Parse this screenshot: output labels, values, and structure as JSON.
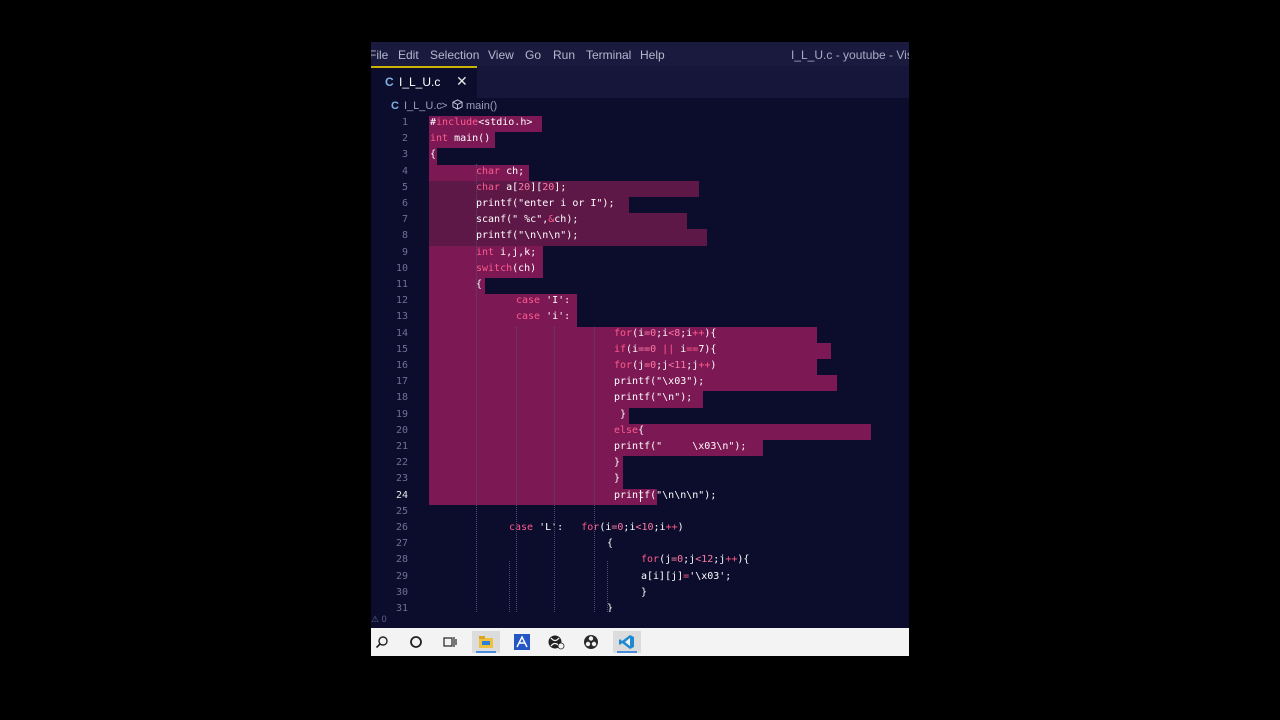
{
  "menu": {
    "items": [
      "File",
      "Edit",
      "Selection",
      "View",
      "Go",
      "Run",
      "Terminal",
      "Help"
    ],
    "window_title": "I_L_U.c - youtube - Visual Studio Code"
  },
  "tab": {
    "lang_icon": "C",
    "filename": "I_L_U.c",
    "close": "✕"
  },
  "breadcrumb": {
    "file_icon": "C",
    "file": "I_L_U.c",
    "sep": ">",
    "symbol_icon": "cube-icon",
    "symbol": "main()"
  },
  "editor": {
    "current_line": 24,
    "lines": [
      {
        "n": 1,
        "i": 0,
        "t": [
          [
            "#",
            "p"
          ],
          [
            "include",
            "k"
          ],
          [
            "<stdio.h>",
            "p"
          ]
        ]
      },
      {
        "n": 2,
        "i": 0,
        "t": [
          [
            "int ",
            "k"
          ],
          [
            "main()",
            "p"
          ]
        ]
      },
      {
        "n": 3,
        "i": 0,
        "t": [
          [
            "{",
            "p"
          ]
        ]
      },
      {
        "n": 4,
        "i": 1,
        "t": [
          [
            "char ",
            "k"
          ],
          [
            "ch;",
            "p"
          ]
        ]
      },
      {
        "n": 5,
        "i": 1,
        "t": [
          [
            "char ",
            "k"
          ],
          [
            "a[",
            "p"
          ],
          [
            "20",
            "n"
          ],
          [
            "][",
            "p"
          ],
          [
            "20",
            "n"
          ],
          [
            "];",
            "p"
          ]
        ]
      },
      {
        "n": 6,
        "i": 1,
        "t": [
          [
            "printf(\"enter i or I\");",
            "p"
          ]
        ]
      },
      {
        "n": 7,
        "i": 1,
        "t": [
          [
            "scanf(\" %c\",",
            "p"
          ],
          [
            "&",
            "k"
          ],
          [
            "ch);",
            "p"
          ]
        ]
      },
      {
        "n": 8,
        "i": 1,
        "t": [
          [
            "printf(\"\\n\\n\\n\");",
            "p"
          ]
        ]
      },
      {
        "n": 9,
        "i": 1,
        "t": [
          [
            "int ",
            "k"
          ],
          [
            "i,j,k;",
            "p"
          ]
        ]
      },
      {
        "n": 10,
        "i": 1,
        "t": [
          [
            "switch",
            "k"
          ],
          [
            "(ch)",
            "p"
          ]
        ]
      },
      {
        "n": 11,
        "i": 1,
        "t": [
          [
            "{",
            "p"
          ]
        ]
      },
      {
        "n": 12,
        "i": 2,
        "t": [
          [
            "case ",
            "k"
          ],
          [
            "'I':",
            "p"
          ]
        ]
      },
      {
        "n": 13,
        "i": 2,
        "t": [
          [
            "case ",
            "k"
          ],
          [
            "'i':",
            "p"
          ]
        ]
      },
      {
        "n": 14,
        "i": 3,
        "t": [
          [
            "for",
            "k"
          ],
          [
            "(i",
            "p"
          ],
          [
            "=0",
            "n"
          ],
          [
            ";i",
            "p"
          ],
          [
            "<8",
            "n"
          ],
          [
            ";i",
            "p"
          ],
          [
            "++",
            "k"
          ],
          [
            "){",
            "p"
          ]
        ]
      },
      {
        "n": 15,
        "i": 3,
        "t": [
          [
            "if",
            "k"
          ],
          [
            "(i",
            "p"
          ],
          [
            "==0",
            "n"
          ],
          [
            " || ",
            "k"
          ],
          [
            "i",
            "p"
          ],
          [
            "==",
            "k"
          ],
          [
            "7){",
            "p"
          ]
        ]
      },
      {
        "n": 16,
        "i": 3,
        "t": [
          [
            "for",
            "k"
          ],
          [
            "(j",
            "p"
          ],
          [
            "=0",
            "n"
          ],
          [
            ";j",
            "p"
          ],
          [
            "<11",
            "n"
          ],
          [
            ";j",
            "p"
          ],
          [
            "++",
            "k"
          ],
          [
            ")",
            "p"
          ]
        ]
      },
      {
        "n": 17,
        "i": 3,
        "t": [
          [
            "printf(\"\\x03\");",
            "p"
          ]
        ]
      },
      {
        "n": 18,
        "i": 3,
        "t": [
          [
            "printf(\"\\n\");",
            "p"
          ]
        ]
      },
      {
        "n": 19,
        "i": 3,
        "t": [
          [
            " }",
            "p"
          ]
        ]
      },
      {
        "n": 20,
        "i": 3,
        "t": [
          [
            "else",
            "k"
          ],
          [
            "{",
            "p"
          ]
        ]
      },
      {
        "n": 21,
        "i": 3,
        "t": [
          [
            "printf(\"     \\x03\\n\");",
            "p"
          ]
        ]
      },
      {
        "n": 22,
        "i": 3,
        "t": [
          [
            "}",
            "p"
          ]
        ]
      },
      {
        "n": 23,
        "i": 3,
        "t": [
          [
            "}",
            "p"
          ]
        ]
      },
      {
        "n": 24,
        "i": 3,
        "t": [
          [
            "printf(\"\\n\\n\\n\");",
            "p"
          ]
        ]
      },
      {
        "n": 25,
        "i": 0,
        "t": []
      },
      {
        "n": 26,
        "i": 4,
        "t": [
          [
            "case ",
            "k"
          ],
          [
            "'L':   ",
            "p"
          ],
          [
            "for",
            "k"
          ],
          [
            "(i",
            "p"
          ],
          [
            "=0",
            "n"
          ],
          [
            ";i",
            "p"
          ],
          [
            "<10",
            "n"
          ],
          [
            ";i",
            "p"
          ],
          [
            "++",
            "k"
          ],
          [
            ")",
            "p"
          ]
        ]
      },
      {
        "n": 27,
        "i": 5,
        "t": [
          [
            "{",
            "p"
          ]
        ]
      },
      {
        "n": 28,
        "i": 6,
        "t": [
          [
            "for",
            "k"
          ],
          [
            "(j",
            "p"
          ],
          [
            "=0",
            "n"
          ],
          [
            ";j",
            "p"
          ],
          [
            "<12",
            "n"
          ],
          [
            ";j",
            "p"
          ],
          [
            "++",
            "k"
          ],
          [
            "){",
            "p"
          ]
        ]
      },
      {
        "n": 29,
        "i": 6,
        "t": [
          [
            "a[i][j]",
            "p"
          ],
          [
            "=",
            "k"
          ],
          [
            "'\\x03';",
            "p"
          ]
        ]
      },
      {
        "n": 30,
        "i": 6,
        "t": [
          [
            "}",
            "p"
          ]
        ]
      },
      {
        "n": 31,
        "i": 5,
        "t": [
          [
            "}",
            "p"
          ]
        ]
      }
    ]
  },
  "status": {
    "problems": "⚠ 0"
  },
  "taskbar": {
    "items": [
      {
        "name": "search-icon"
      },
      {
        "name": "cortana-icon"
      },
      {
        "name": "task-view-icon"
      },
      {
        "name": "file-explorer-icon"
      },
      {
        "name": "app-icon"
      },
      {
        "name": "xbox-icon"
      },
      {
        "name": "obs-icon"
      },
      {
        "name": "vscode-icon"
      }
    ]
  },
  "colors": {
    "editor_bg": "#0c0d2c",
    "selection": "#7c1955",
    "keyword": "#ff5a8c",
    "tab_accent": "#c8b400"
  }
}
